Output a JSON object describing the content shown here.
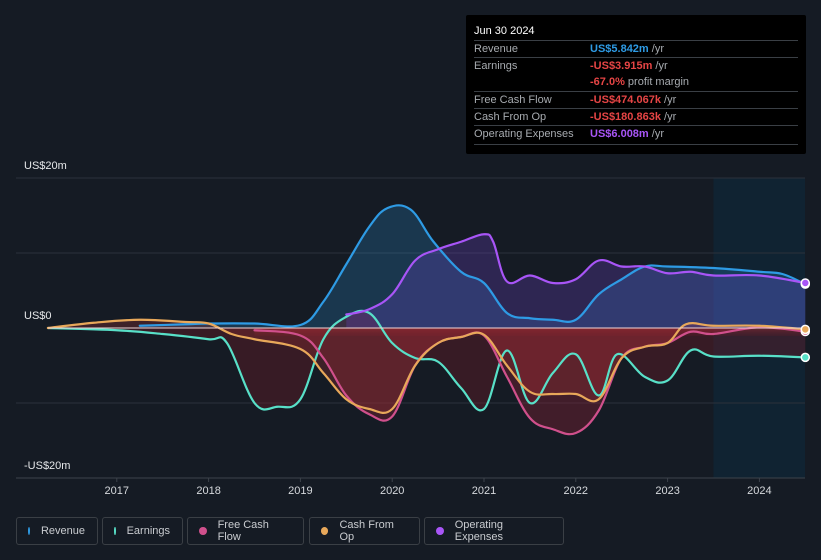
{
  "tooltip": {
    "date": "Jun 30 2024",
    "rows": [
      {
        "label": "Revenue",
        "value": "US$5.842m",
        "suffix": " /yr",
        "color": "#2e9be5"
      },
      {
        "label": "Earnings",
        "value": "-US$3.915m",
        "suffix": " /yr",
        "color": "#e64545"
      },
      {
        "label": "",
        "value": "-67.0%",
        "suffix": " profit margin",
        "color": "#e64545"
      },
      {
        "label": "Free Cash Flow",
        "value": "-US$474.067k",
        "suffix": " /yr",
        "color": "#e64545"
      },
      {
        "label": "Cash From Op",
        "value": "-US$180.863k",
        "suffix": " /yr",
        "color": "#e64545"
      },
      {
        "label": "Operating Expenses",
        "value": "US$6.008m",
        "suffix": " /yr",
        "color": "#a855f7"
      }
    ]
  },
  "chart_data": {
    "type": "line",
    "title": "",
    "xlabel": "",
    "ylabel": "",
    "y_tick_labels": [
      "US$20m",
      "US$0",
      "-US$20m"
    ],
    "ylim": [
      -20,
      20
    ],
    "xlim": [
      2016.0,
      2024.6
    ],
    "x_ticks": [
      2017,
      2018,
      2019,
      2020,
      2021,
      2022,
      2023,
      2024
    ],
    "x_tick_labels": [
      "2017",
      "2018",
      "2019",
      "2020",
      "2021",
      "2022",
      "2023",
      "2024"
    ],
    "grid": true,
    "highlight_from": 2023.5,
    "legend_position": "bottom",
    "unit": "US$m",
    "series": [
      {
        "name": "Revenue",
        "color": "#2e9be5",
        "x": [
          2017.25,
          2017.75,
          2018.0,
          2018.5,
          2019.0,
          2019.25,
          2019.5,
          2019.75,
          2019.95,
          2020.2,
          2020.45,
          2020.75,
          2021.0,
          2021.25,
          2021.5,
          2021.75,
          2022.0,
          2022.25,
          2022.5,
          2022.75,
          2023.0,
          2023.5,
          2024.0,
          2024.25,
          2024.5
        ],
        "values": [
          0.3,
          0.5,
          0.6,
          0.6,
          0.4,
          3.5,
          8.5,
          13.5,
          16.0,
          15.8,
          11.5,
          7.5,
          6.0,
          2.0,
          1.3,
          1.1,
          1.1,
          4.5,
          6.5,
          8.2,
          8.2,
          8.0,
          7.5,
          7.2,
          5.842
        ]
      },
      {
        "name": "Earnings",
        "color": "#58e0c8",
        "x": [
          2016.25,
          2017.0,
          2017.5,
          2018.0,
          2018.2,
          2018.5,
          2018.75,
          2019.0,
          2019.25,
          2019.5,
          2019.75,
          2020.0,
          2020.25,
          2020.5,
          2020.75,
          2021.0,
          2021.25,
          2021.5,
          2021.75,
          2022.0,
          2022.25,
          2022.45,
          2022.75,
          2023.0,
          2023.25,
          2023.5,
          2024.0,
          2024.5
        ],
        "values": [
          0,
          -0.3,
          -0.8,
          -1.5,
          -2.0,
          -10.0,
          -10.5,
          -9.5,
          -1.5,
          1.5,
          2.0,
          -2.0,
          -4.0,
          -4.5,
          -8.0,
          -10.8,
          -3.0,
          -10.0,
          -6.0,
          -3.5,
          -9.0,
          -3.5,
          -6.5,
          -7.0,
          -3.0,
          -3.8,
          -3.7,
          -3.915
        ]
      },
      {
        "name": "Free Cash Flow",
        "color": "#d0508c",
        "x": [
          2018.5,
          2019.0,
          2019.25,
          2019.5,
          2019.75,
          2020.0,
          2020.25,
          2020.5,
          2020.75,
          2021.0,
          2021.25,
          2021.5,
          2021.75,
          2022.0,
          2022.25,
          2022.5,
          2022.75,
          2023.0,
          2023.25,
          2023.5,
          2024.0,
          2024.5
        ],
        "values": [
          -0.3,
          -1.0,
          -4.0,
          -9.0,
          -11.5,
          -11.8,
          -5.0,
          -2.0,
          -1.2,
          -1.0,
          -6.5,
          -12.0,
          -13.5,
          -14.0,
          -11.0,
          -4.0,
          -2.5,
          -2.0,
          -0.5,
          -0.8,
          0.1,
          -0.474
        ]
      },
      {
        "name": "Cash From Op",
        "color": "#e8a85a",
        "x": [
          2016.25,
          2016.75,
          2017.25,
          2017.75,
          2018.0,
          2018.25,
          2018.5,
          2019.0,
          2019.25,
          2019.5,
          2019.75,
          2020.0,
          2020.25,
          2020.5,
          2020.75,
          2021.0,
          2021.25,
          2021.5,
          2021.75,
          2022.0,
          2022.25,
          2022.5,
          2022.75,
          2023.0,
          2023.2,
          2023.5,
          2024.0,
          2024.5
        ],
        "values": [
          0,
          0.7,
          1.1,
          0.8,
          0.6,
          -0.8,
          -1.5,
          -2.8,
          -6.0,
          -9.5,
          -10.8,
          -10.8,
          -5.0,
          -2.0,
          -1.2,
          -0.9,
          -5.0,
          -8.5,
          -8.8,
          -8.8,
          -9.5,
          -4.0,
          -2.5,
          -2.0,
          0.5,
          0.3,
          0.3,
          -0.181
        ]
      },
      {
        "name": "Operating Expenses",
        "color": "#a855f7",
        "x": [
          2019.5,
          2019.75,
          2020.0,
          2020.25,
          2020.5,
          2020.75,
          2021.0,
          2021.1,
          2021.25,
          2021.5,
          2021.75,
          2022.0,
          2022.25,
          2022.5,
          2022.75,
          2023.0,
          2023.25,
          2023.5,
          2024.0,
          2024.5
        ],
        "values": [
          1.8,
          2.5,
          4.5,
          9.0,
          10.5,
          11.5,
          12.5,
          11.5,
          6.2,
          7.0,
          6.0,
          6.5,
          9.0,
          8.2,
          8.2,
          7.3,
          7.5,
          7.0,
          7.0,
          6.008
        ]
      }
    ]
  },
  "legend": [
    {
      "label": "Revenue",
      "color": "#2e9be5"
    },
    {
      "label": "Earnings",
      "color": "#58e0c8"
    },
    {
      "label": "Free Cash Flow",
      "color": "#d0508c"
    },
    {
      "label": "Cash From Op",
      "color": "#e8a85a"
    },
    {
      "label": "Operating Expenses",
      "color": "#a855f7"
    }
  ]
}
